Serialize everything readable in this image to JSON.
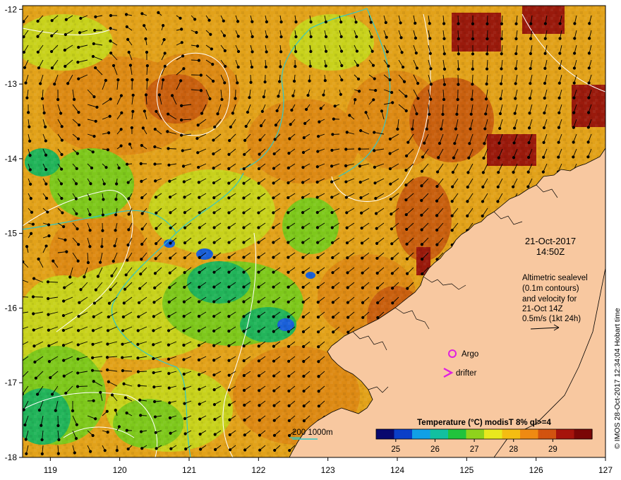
{
  "map": {
    "lon_ticks": [
      "119",
      "120",
      "121",
      "122",
      "123",
      "124",
      "125",
      "126",
      "127"
    ],
    "lat_ticks": [
      "-12",
      "-13",
      "-14",
      "-15",
      "-16",
      "-17",
      "-18"
    ],
    "lon_range": [
      118.6,
      127
    ],
    "lat_range": [
      -18,
      -11.95
    ],
    "land_color": "#f8c8a0",
    "ocean_warm": "#d27a0e",
    "ocean_cool": "#9ad317"
  },
  "annotations": {
    "date": "21-Oct-2017",
    "time": "14:50Z",
    "legend_line1": "Altimetric sealevel",
    "legend_line2": "(0.1m contours)",
    "legend_line3": "and velocity for",
    "legend_line4": "21-Oct 14Z",
    "legend_line5": "0.5m/s (1kt 24h)",
    "argo_label": "Argo",
    "drifter_label": "drifter",
    "depth_label": "200  1000m",
    "credit": "© IMOS 28-Oct-2017 12:34:04 Hobart time"
  },
  "colorbar": {
    "title": "Temperature (°C) modisT 8% ql>=4",
    "ticks": [
      "25",
      "26",
      "27",
      "28",
      "29"
    ],
    "tick_values": [
      25,
      26,
      27,
      28,
      29
    ],
    "range": [
      24.5,
      30.0
    ],
    "colors": [
      "#08086e",
      "#0a3fc8",
      "#11a0e6",
      "#12c0a0",
      "#20c33c",
      "#8fd21c",
      "#e8e81e",
      "#f4bd12",
      "#ef8a12",
      "#d2530f",
      "#a6140c",
      "#7a0606"
    ]
  },
  "colors": {
    "argo": "#e020e0",
    "drifter": "#e020e0",
    "contour_200": "#30c8c8",
    "sealevel_contour": "#ffffff",
    "arrows": "#000000"
  },
  "icons": {
    "argo_marker": "circle-icon",
    "drifter_marker": "chevron-icon",
    "velocity_scale": "arrow-icon"
  }
}
